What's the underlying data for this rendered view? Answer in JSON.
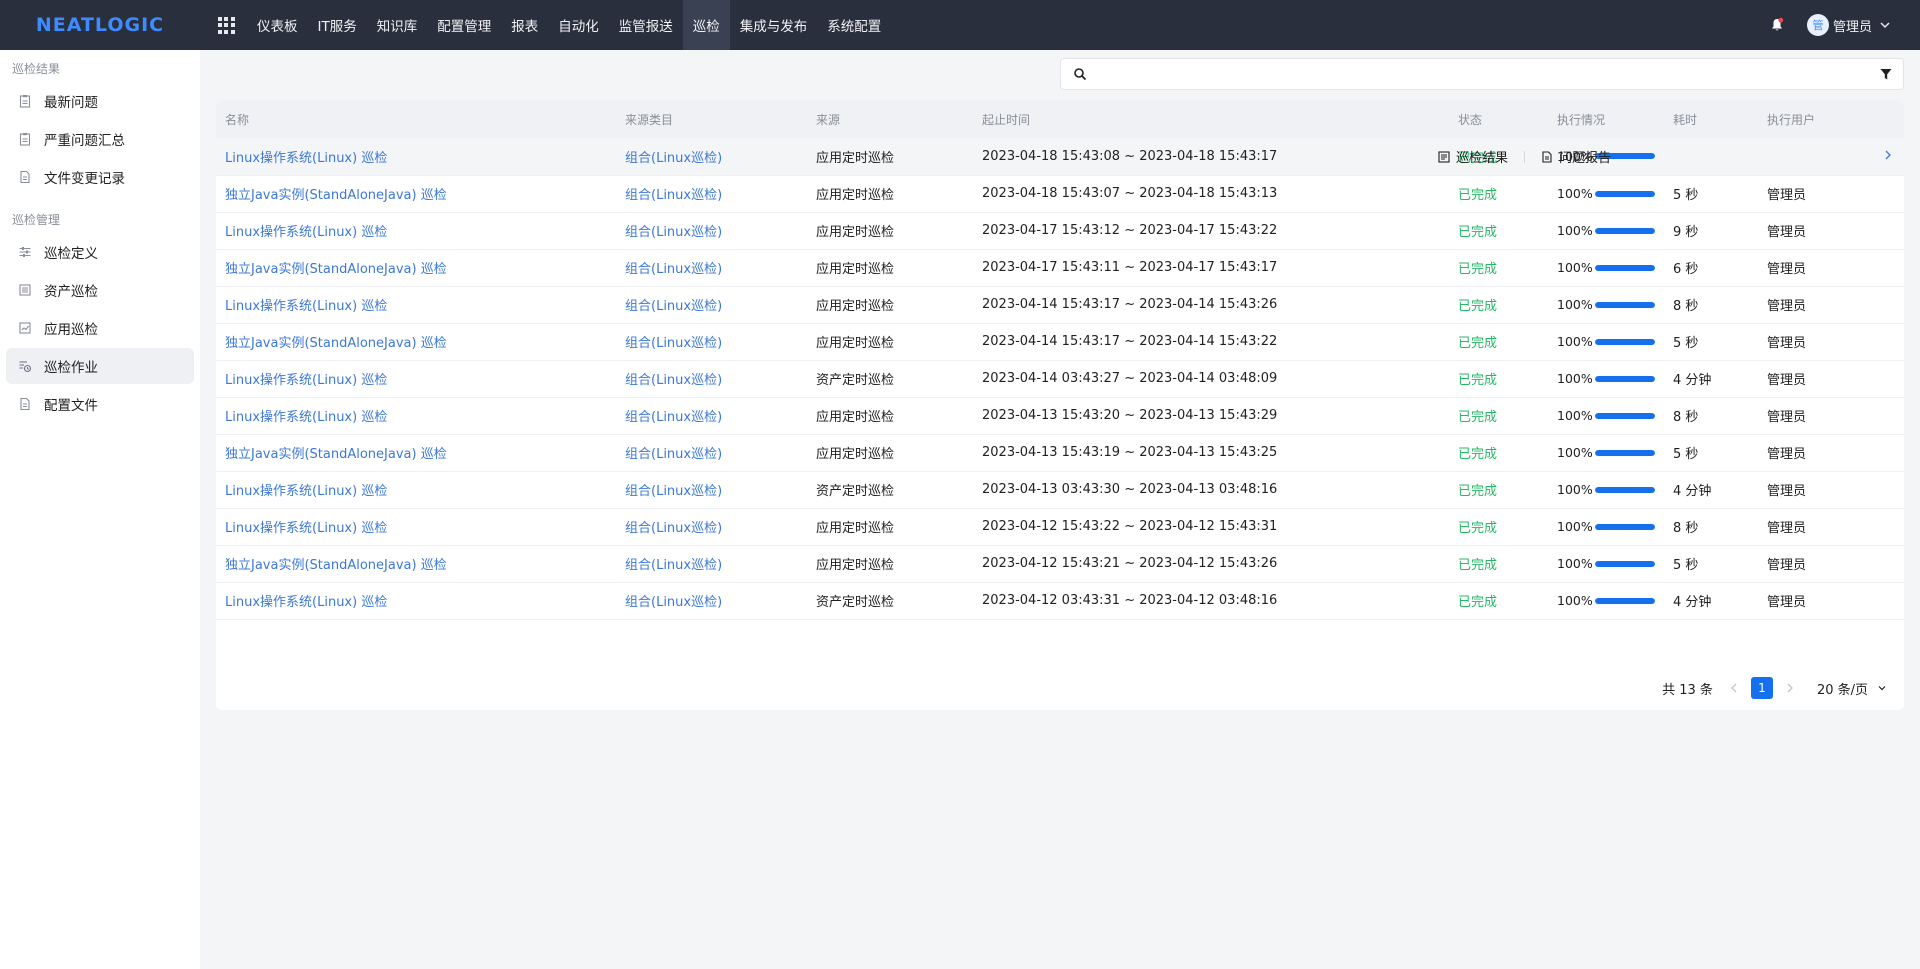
{
  "brand": {
    "logo_text": "NEATLOGIC",
    "accent_color": "#3c8bff",
    "topbar_color": "#2a2f3d"
  },
  "nav": {
    "items": [
      {
        "label": "仪表板",
        "active": false
      },
      {
        "label": "IT服务",
        "active": false
      },
      {
        "label": "知识库",
        "active": false
      },
      {
        "label": "配置管理",
        "active": false
      },
      {
        "label": "报表",
        "active": false
      },
      {
        "label": "自动化",
        "active": false
      },
      {
        "label": "监管报送",
        "active": false
      },
      {
        "label": "巡检",
        "active": true
      },
      {
        "label": "集成与发布",
        "active": false
      },
      {
        "label": "系统配置",
        "active": false
      }
    ]
  },
  "user": {
    "avatar_text": "管",
    "name": "管理员"
  },
  "sidebar": {
    "groups": [
      {
        "title": "巡检结果",
        "items": [
          {
            "label": "最新问题",
            "icon": "clipboard-icon"
          },
          {
            "label": "严重问题汇总",
            "icon": "clipboard-icon"
          },
          {
            "label": "文件变更记录",
            "icon": "file-icon"
          }
        ]
      },
      {
        "title": "巡检管理",
        "items": [
          {
            "label": "巡检定义",
            "icon": "sliders-icon"
          },
          {
            "label": "资产巡检",
            "icon": "list-icon"
          },
          {
            "label": "应用巡检",
            "icon": "app-check-icon"
          },
          {
            "label": "巡检作业",
            "icon": "job-icon",
            "active": true
          },
          {
            "label": "配置文件",
            "icon": "file-icon"
          }
        ]
      }
    ]
  },
  "search": {
    "placeholder": "",
    "value": ""
  },
  "table": {
    "headers": [
      "名称",
      "来源类目",
      "来源",
      "起止时间",
      "状态",
      "执行情况",
      "耗时",
      "执行用户"
    ],
    "rows": [
      {
        "name": "Linux操作系统(Linux) 巡检",
        "category": "组合(Linux巡检)",
        "source": "应用定时巡检",
        "time": "2023-04-18 15:43:08 ~ 2023-04-18 15:43:17",
        "status": "已完成",
        "percent": "100%",
        "progress": 1.0,
        "duration": "",
        "user": ""
      },
      {
        "name": "独立Java实例(StandAloneJava) 巡检",
        "category": "组合(Linux巡检)",
        "source": "应用定时巡检",
        "time": "2023-04-18 15:43:07 ~ 2023-04-18 15:43:13",
        "status": "已完成",
        "percent": "100%",
        "progress": 1.0,
        "duration": "5 秒",
        "user": "管理员"
      },
      {
        "name": "Linux操作系统(Linux) 巡检",
        "category": "组合(Linux巡检)",
        "source": "应用定时巡检",
        "time": "2023-04-17 15:43:12 ~ 2023-04-17 15:43:22",
        "status": "已完成",
        "percent": "100%",
        "progress": 1.0,
        "duration": "9 秒",
        "user": "管理员"
      },
      {
        "name": "独立Java实例(StandAloneJava) 巡检",
        "category": "组合(Linux巡检)",
        "source": "应用定时巡检",
        "time": "2023-04-17 15:43:11 ~ 2023-04-17 15:43:17",
        "status": "已完成",
        "percent": "100%",
        "progress": 1.0,
        "duration": "6 秒",
        "user": "管理员"
      },
      {
        "name": "Linux操作系统(Linux) 巡检",
        "category": "组合(Linux巡检)",
        "source": "应用定时巡检",
        "time": "2023-04-14 15:43:17 ~ 2023-04-14 15:43:26",
        "status": "已完成",
        "percent": "100%",
        "progress": 1.0,
        "duration": "8 秒",
        "user": "管理员"
      },
      {
        "name": "独立Java实例(StandAloneJava) 巡检",
        "category": "组合(Linux巡检)",
        "source": "应用定时巡检",
        "time": "2023-04-14 15:43:17 ~ 2023-04-14 15:43:22",
        "status": "已完成",
        "percent": "100%",
        "progress": 1.0,
        "duration": "5 秒",
        "user": "管理员"
      },
      {
        "name": "Linux操作系统(Linux) 巡检",
        "category": "组合(Linux巡检)",
        "source": "资产定时巡检",
        "time": "2023-04-14 03:43:27 ~ 2023-04-14 03:48:09",
        "status": "已完成",
        "percent": "100%",
        "progress": 1.0,
        "duration": "4 分钟",
        "user": "管理员"
      },
      {
        "name": "Linux操作系统(Linux) 巡检",
        "category": "组合(Linux巡检)",
        "source": "应用定时巡检",
        "time": "2023-04-13 15:43:20 ~ 2023-04-13 15:43:29",
        "status": "已完成",
        "percent": "100%",
        "progress": 1.0,
        "duration": "8 秒",
        "user": "管理员"
      },
      {
        "name": "独立Java实例(StandAloneJava) 巡检",
        "category": "组合(Linux巡检)",
        "source": "应用定时巡检",
        "time": "2023-04-13 15:43:19 ~ 2023-04-13 15:43:25",
        "status": "已完成",
        "percent": "100%",
        "progress": 1.0,
        "duration": "5 秒",
        "user": "管理员"
      },
      {
        "name": "Linux操作系统(Linux) 巡检",
        "category": "组合(Linux巡检)",
        "source": "资产定时巡检",
        "time": "2023-04-13 03:43:30 ~ 2023-04-13 03:48:16",
        "status": "已完成",
        "percent": "100%",
        "progress": 1.0,
        "duration": "4 分钟",
        "user": "管理员"
      },
      {
        "name": "Linux操作系统(Linux) 巡检",
        "category": "组合(Linux巡检)",
        "source": "应用定时巡检",
        "time": "2023-04-12 15:43:22 ~ 2023-04-12 15:43:31",
        "status": "已完成",
        "percent": "100%",
        "progress": 1.0,
        "duration": "8 秒",
        "user": "管理员"
      },
      {
        "name": "独立Java实例(StandAloneJava) 巡检",
        "category": "组合(Linux巡检)",
        "source": "应用定时巡检",
        "time": "2023-04-12 15:43:21 ~ 2023-04-12 15:43:26",
        "status": "已完成",
        "percent": "100%",
        "progress": 1.0,
        "duration": "5 秒",
        "user": "管理员"
      },
      {
        "name": "Linux操作系统(Linux) 巡检",
        "category": "组合(Linux巡检)",
        "source": "资产定时巡检",
        "time": "2023-04-12 03:43:31 ~ 2023-04-12 03:48:16",
        "status": "已完成",
        "percent": "100%",
        "progress": 1.0,
        "duration": "4 分钟",
        "user": "管理员"
      }
    ],
    "row_actions": {
      "result_label": "巡检结果",
      "report_label": "问题报告"
    }
  },
  "pagination": {
    "total_label": "共 13 条",
    "current_page": "1",
    "page_size_label": "20 条/页"
  }
}
